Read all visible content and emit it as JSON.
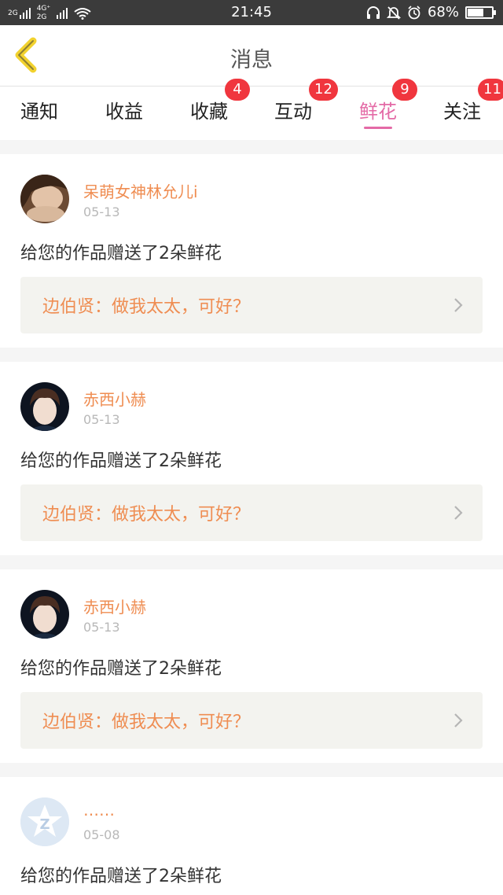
{
  "status_bar": {
    "net1": "2G",
    "net2": "4G⁺",
    "net3": "2G",
    "time": "21:45",
    "battery": "68%",
    "battery_level": 0.68,
    "icons": [
      "headset-icon",
      "mute-icon",
      "alarm-icon",
      "wifi-icon"
    ]
  },
  "header": {
    "title": "消息",
    "back_icon": "chevron-left-icon",
    "accent": "#f2d22e"
  },
  "tabs": [
    {
      "label": "通知",
      "badge": ""
    },
    {
      "label": "收益",
      "badge": ""
    },
    {
      "label": "收藏",
      "badge": "4"
    },
    {
      "label": "互动",
      "badge": "12"
    },
    {
      "label": "鲜花",
      "badge": "9",
      "active": true
    },
    {
      "label": "关注",
      "badge": "11"
    }
  ],
  "active_color": "#e46aa6",
  "messages": [
    {
      "user": "呆萌女神林允儿i",
      "date": "05-13",
      "text": "给您的作品赠送了2朵鲜花",
      "work": "边伯贤：做我太太，可好？",
      "avatar": "avatar-photo"
    },
    {
      "user": "赤西小赫",
      "date": "05-13",
      "text": "给您的作品赠送了2朵鲜花",
      "work": "边伯贤：做我太太，可好？",
      "avatar": "avatar-photo"
    },
    {
      "user": "赤西小赫",
      "date": "05-13",
      "text": "给您的作品赠送了2朵鲜花",
      "work": "边伯贤：做我太太，可好？",
      "avatar": "avatar-photo"
    },
    {
      "user": "……",
      "date": "05-08",
      "text": "给您的作品赠送了2朵鲜花",
      "work": "",
      "avatar": "default-avatar-icon"
    }
  ]
}
